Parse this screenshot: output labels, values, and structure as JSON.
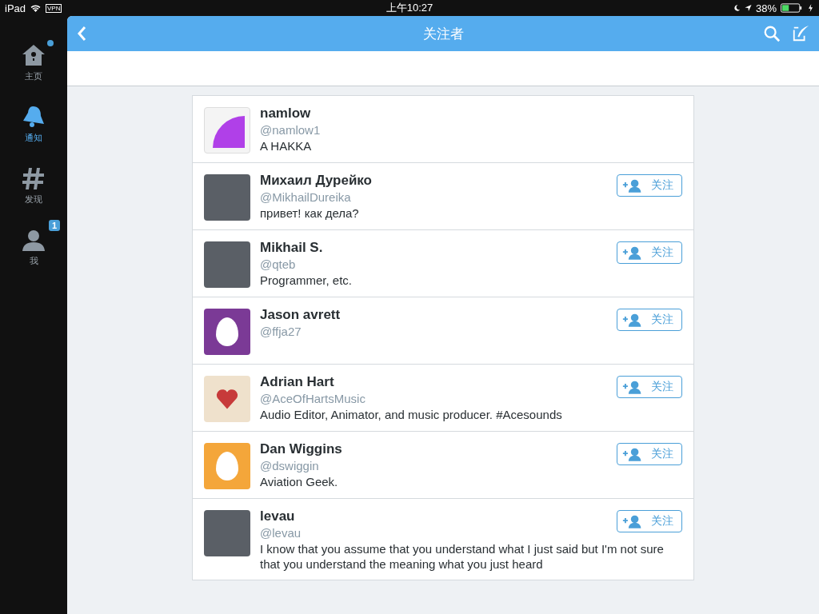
{
  "status_bar": {
    "device": "iPad",
    "vpn": "VPN",
    "time": "上午10:27",
    "battery": "38%"
  },
  "sidebar": {
    "items": [
      {
        "kind": "home",
        "label": "主页",
        "selected": false,
        "dot": true
      },
      {
        "kind": "bell",
        "label": "通知",
        "selected": true,
        "dot": false
      },
      {
        "kind": "hash",
        "label": "发现",
        "selected": false,
        "dot": false
      },
      {
        "kind": "person",
        "label": "我",
        "selected": false,
        "dot": false,
        "badge": "1"
      }
    ]
  },
  "header": {
    "title": "关注者"
  },
  "users": [
    {
      "name": "namlow",
      "handle": "@namlow1",
      "bio": "A HAKKA",
      "avatar": {
        "kind": "chart"
      }
    },
    {
      "name": "Михаил Дурейко",
      "handle": "@MikhailDureika",
      "bio": "привет! как дела?",
      "avatar": {
        "kind": "photo"
      },
      "follow_button": "关注"
    },
    {
      "name": "Mikhail S.",
      "handle": "@qteb",
      "bio": "Programmer, etc.",
      "avatar": {
        "kind": "photo"
      },
      "follow_button": "关注"
    },
    {
      "name": "Jason avrett",
      "handle": "@ffja27",
      "avatar": {
        "kind": "egg",
        "color": "#7b3a96"
      },
      "follow_button": "关注"
    },
    {
      "name": "Adrian Hart",
      "handle": "@AceOfHartsMusic",
      "bio": "Audio Editor, Animator, and music producer. #Acesounds",
      "avatar": {
        "kind": "heart"
      },
      "follow_button": "关注"
    },
    {
      "name": "Dan Wiggins",
      "handle": "@dswiggin",
      "bio": "Aviation Geek.",
      "avatar": {
        "kind": "egg",
        "color": "#f4a63a"
      },
      "follow_button": "关注"
    },
    {
      "name": "levau",
      "handle": "@levau",
      "bio": "I know that you assume that you understand what I just said but I'm not sure that you understand the meaning what you just heard",
      "avatar": {
        "kind": "photo"
      },
      "follow_button": "关注"
    }
  ]
}
